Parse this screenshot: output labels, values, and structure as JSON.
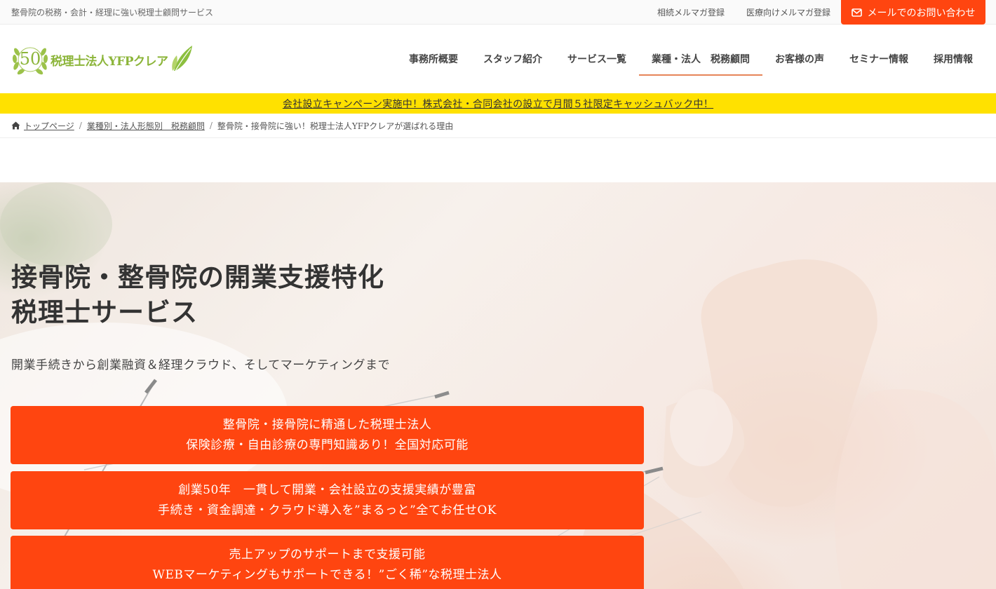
{
  "topbar": {
    "tagline": "整骨院の税務・会計・経理に強い税理士顧問サービス",
    "links": [
      "相続メルマガ登録",
      "医療向けメルマガ登録"
    ],
    "contact_label": "メールでのお問い合わせ"
  },
  "logo": {
    "seal_number": "50",
    "name": "税理士法人YFPクレア"
  },
  "nav": {
    "items": [
      "事務所概要",
      "スタッフ紹介",
      "サービス一覧",
      "業種・法人　税務顧問",
      "お客様の声",
      "セミナー情報",
      "採用情報"
    ],
    "active_index": 3
  },
  "campaign": {
    "text": "会社設立キャンペーン実施中！株式会社・合同会社の設立で月間５社限定キャッシュバック中！"
  },
  "breadcrumb": {
    "items": [
      "トップページ",
      "業種別・法人形態別　税務顧問",
      "整骨院・接骨院に強い！税理士法人YFPクレアが選ばれる理由"
    ]
  },
  "hero": {
    "title_line1": "接骨院・整骨院の開業支援特化",
    "title_line2": "税理士サービス",
    "subtitle": "開業手続きから創業融資＆経理クラウド、そしてマーケティングまで",
    "boxes": [
      {
        "line1": "整骨院・接骨院に精通した税理士法人",
        "line2": "保険診療・自由診療の専門知識あり！全国対応可能"
      },
      {
        "line1": "創業50年　一貫して開業・会社設立の支援実績が豊富",
        "line2": "手続き・資金調達・クラウド導入を”まるっと”全てお任せOK"
      },
      {
        "line1": "売上アップのサポートまで支援可能",
        "line2": "WEBマーケティングもサポートできる！”ごく稀”な税理士法人"
      }
    ]
  },
  "colors": {
    "accent": "#ff4510",
    "campaign_bg": "#ffe100",
    "logo_green": "#8cb53a"
  }
}
